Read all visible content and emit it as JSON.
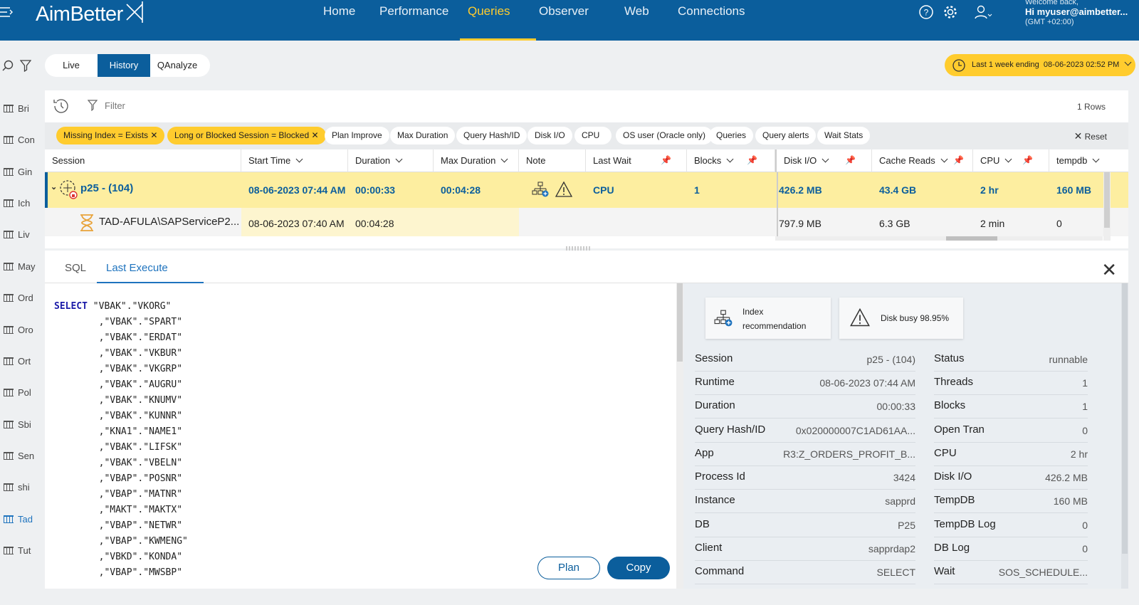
{
  "app": {
    "logo": "AimBetter"
  },
  "nav": {
    "items": [
      {
        "label": "Home"
      },
      {
        "label": "Performance"
      },
      {
        "label": "Queries"
      },
      {
        "label": "Observer"
      },
      {
        "label": "Web"
      },
      {
        "label": "Connections"
      }
    ],
    "active": "Queries"
  },
  "user": {
    "welcome": "Welcome back,",
    "name": "Hi myuser@aimbetter...",
    "tz": "(GMT +02:00)"
  },
  "rail": {
    "items": [
      {
        "label": "Bri"
      },
      {
        "label": "Con"
      },
      {
        "label": "Gin"
      },
      {
        "label": "Ich"
      },
      {
        "label": "Liv"
      },
      {
        "label": "May"
      },
      {
        "label": "Ord"
      },
      {
        "label": "Oro"
      },
      {
        "label": "Ort"
      },
      {
        "label": "Pol"
      },
      {
        "label": "Sbi"
      },
      {
        "label": "Sen"
      },
      {
        "label": "shi"
      },
      {
        "label": "Tad"
      },
      {
        "label": "Tut"
      }
    ],
    "active": "Tad"
  },
  "modes": {
    "live": "Live",
    "history": "History",
    "qanalyze": "QAnalyze",
    "active": "History"
  },
  "range": {
    "label": "Last 1 week ending",
    "date": "08-06-2023 02:52 PM"
  },
  "filter": {
    "placeholder": "Filter",
    "rows": "1 Rows",
    "reset": "Reset"
  },
  "chips": [
    {
      "label": "Missing Index = Exists",
      "active": true
    },
    {
      "label": "Long or Blocked Session = Blocked",
      "active": true
    },
    {
      "label": "Plan Improve",
      "active": false
    },
    {
      "label": "Max Duration",
      "active": false
    },
    {
      "label": "Query Hash/ID",
      "active": false
    },
    {
      "label": "Disk I/O",
      "active": false
    },
    {
      "label": "CPU",
      "active": false
    },
    {
      "label": "OS user (Oracle only)",
      "active": false
    },
    {
      "label": "Queries",
      "active": false
    },
    {
      "label": "Query alerts",
      "active": false
    },
    {
      "label": "Wait Stats",
      "active": false
    }
  ],
  "columns": {
    "session": "Session",
    "start": "Start Time",
    "duration": "Duration",
    "max_duration": "Max Duration",
    "note": "Note",
    "last_wait": "Last Wait",
    "blocks": "Blocks",
    "disk_io": "Disk I/O",
    "cache_reads": "Cache Reads",
    "cpu": "CPU",
    "tempdb": "tempdb"
  },
  "rows": [
    {
      "session": "p25 - (104)",
      "start": "08-06-2023 07:44 AM",
      "duration": "00:00:33",
      "max_duration": "00:04:28",
      "last_wait": "CPU",
      "blocks": "1",
      "disk_io": "426.2 MB",
      "cache_reads": "43.4 GB",
      "cpu": "2 hr",
      "tempdb": "160 MB"
    },
    {
      "session": "TAD-AFULA\\SAPServiceP2...",
      "start": "08-06-2023 07:40 AM",
      "duration": "00:04:28",
      "disk_io": "797.9 MB",
      "cache_reads": "6.3 GB",
      "cpu": "2 min",
      "tempdb": "0"
    }
  ],
  "detail": {
    "tabs": {
      "sql": "SQL",
      "last_execute": "Last Execute"
    },
    "active_tab": "Last Execute",
    "sql": {
      "keyword": "SELECT",
      "first": "\"VBAK\".\"VKORG\"",
      "lines": [
        ",\"VBAK\".\"SPART\"",
        ",\"VBAK\".\"ERDAT\"",
        ",\"VBAK\".\"VKBUR\"",
        ",\"VBAK\".\"VKGRP\"",
        ",\"VBAK\".\"AUGRU\"",
        ",\"VBAK\".\"KNUMV\"",
        ",\"VBAK\".\"KUNNR\"",
        ",\"KNA1\".\"NAME1\"",
        ",\"VBAK\".\"LIFSK\"",
        ",\"VBAK\".\"VBELN\"",
        ",\"VBAP\".\"POSNR\"",
        ",\"VBAP\".\"MATNR\"",
        ",\"MAKT\".\"MAKTX\"",
        ",\"VBAP\".\"NETWR\"",
        ",\"VBAP\".\"KWMENG\"",
        ",\"VBKD\".\"KONDA\"",
        ",\"VBAP\".\"MWSBP\""
      ]
    },
    "buttons": {
      "plan": "Plan",
      "copy": "Copy"
    },
    "cards": {
      "index": "Index recommendation",
      "disk": "Disk busy 98.95%"
    },
    "left_fields": [
      {
        "k": "Session",
        "v": "p25 - (104)"
      },
      {
        "k": "Runtime",
        "v": "08-06-2023 07:44 AM"
      },
      {
        "k": "Duration",
        "v": "00:00:33"
      },
      {
        "k": "Query Hash/ID",
        "v": "0x020000007C1AD61AA..."
      },
      {
        "k": "App",
        "v": "R3:Z_ORDERS_PROFIT_B..."
      },
      {
        "k": "Process Id",
        "v": "3424"
      },
      {
        "k": "Instance",
        "v": "sapprd"
      },
      {
        "k": "DB",
        "v": "P25"
      },
      {
        "k": "Client",
        "v": "sapprdap2"
      },
      {
        "k": "Command",
        "v": "SELECT"
      }
    ],
    "right_fields": [
      {
        "k": "Status",
        "v": "runnable"
      },
      {
        "k": "Threads",
        "v": "1"
      },
      {
        "k": "Blocks",
        "v": "1"
      },
      {
        "k": "Open Tran",
        "v": "0"
      },
      {
        "k": "CPU",
        "v": "2 hr"
      },
      {
        "k": "Disk I/O",
        "v": "426.2 MB"
      },
      {
        "k": "TempDB",
        "v": "160 MB"
      },
      {
        "k": "TempDB Log",
        "v": "0"
      },
      {
        "k": "DB Log",
        "v": "0"
      },
      {
        "k": "Wait",
        "v": "SOS_SCHEDULE..."
      }
    ]
  },
  "colors": {
    "primary": "#0b5e9c",
    "accent": "#ffcc2e",
    "row_highlight": "#fdeea0",
    "link": "#1e73be"
  }
}
